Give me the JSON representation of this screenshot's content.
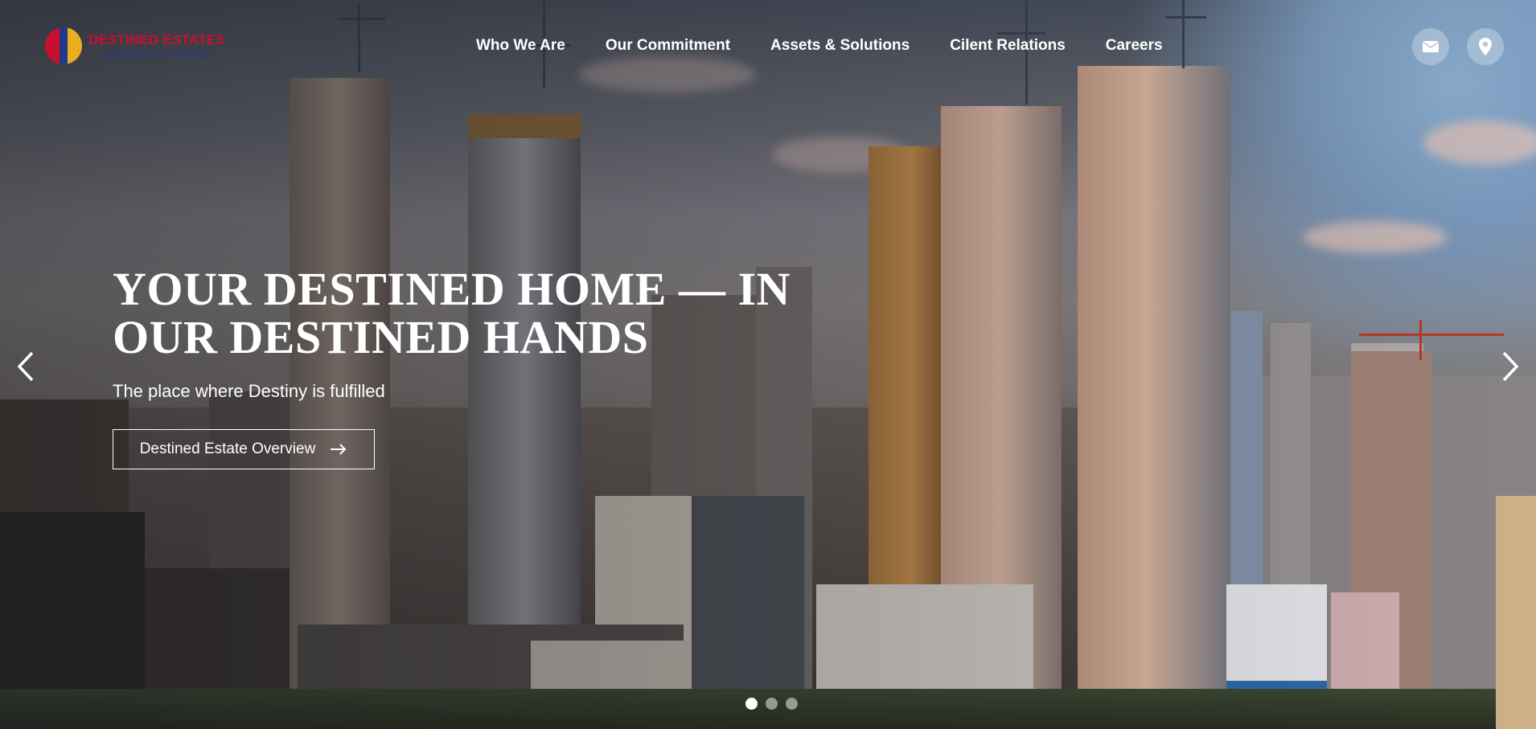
{
  "brand": {
    "name": "DESTINED ESTATES",
    "subtitle": "(OPC) PRIVATE LIMITED"
  },
  "nav": {
    "items": [
      {
        "label": "Who We Are"
      },
      {
        "label": "Our Commitment"
      },
      {
        "label": "Assets & Solutions"
      },
      {
        "label": "Cilent Relations"
      },
      {
        "label": "Careers"
      }
    ]
  },
  "header_icons": [
    "mail-icon",
    "location-pin-icon"
  ],
  "hero": {
    "headline": "YOUR DESTINED HOME — IN OUR DESTINED HANDS",
    "subline": "The place where Destiny is fulfilled",
    "cta_label": "Destined Estate Overview"
  },
  "carousel": {
    "slide_count": 3,
    "active_slide": 1
  },
  "colors": {
    "brand_red": "#c8102e",
    "brand_blue": "#1f3a8a",
    "brand_yellow": "#e8b020",
    "text_light": "#ffffff"
  }
}
